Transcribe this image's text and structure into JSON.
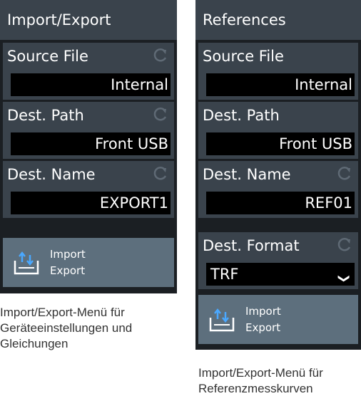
{
  "panel_a": {
    "title": "Import/Export",
    "rows": [
      {
        "label": "Source File",
        "value": "Internal"
      },
      {
        "label": "Dest. Path",
        "value": "Front USB"
      },
      {
        "label": "Dest. Name",
        "value": "EXPORT1"
      }
    ],
    "button": {
      "line1": "Import",
      "line2": "Export"
    },
    "caption": "Import/Export-Menü für Geräteeinstellungen und Gleichungen"
  },
  "panel_b": {
    "title": "References",
    "rows": [
      {
        "label": "Source File",
        "value": "Internal"
      },
      {
        "label": "Dest. Path",
        "value": "Front USB"
      },
      {
        "label": "Dest. Name",
        "value": "REF01"
      },
      {
        "label": "Dest. Format",
        "value": "TRF"
      }
    ],
    "button": {
      "line1": "Import",
      "line2": "Export"
    },
    "caption": "Import/Export-Menü für Referenzmesskurven"
  },
  "colors": {
    "panel_bg": "#1b1f23",
    "section_bg": "#3a434c",
    "button_bg": "#5d6f7d",
    "accent": "#4aa8ff"
  },
  "icons": {
    "reset": "reset-arrow-icon",
    "import_export": "import-export-icon",
    "dropdown": "chevron-down-icon"
  }
}
